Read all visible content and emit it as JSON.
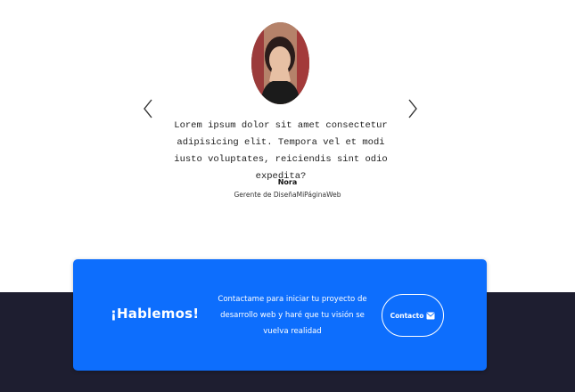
{
  "testimonial": {
    "quote": "Lorem ipsum dolor sit amet consectetur adipisicing elit. Tempora vel et modi iusto voluptates, reiciendis sint odio expedita?",
    "author": "Nora",
    "role": "Gerente de DiseñaMiPáginaWeb",
    "prev_icon": "chevron-left-icon",
    "next_icon": "chevron-right-icon"
  },
  "cta": {
    "title": "¡Hablemos!",
    "text": "Contactame para iniciar tu proyecto de desarrollo web y haré que tu visión se vuelva realidad",
    "button_label": "Contacto",
    "button_icon": "envelope-icon",
    "background": "#0d6efd"
  },
  "colors": {
    "footer": "#1e1e30"
  }
}
